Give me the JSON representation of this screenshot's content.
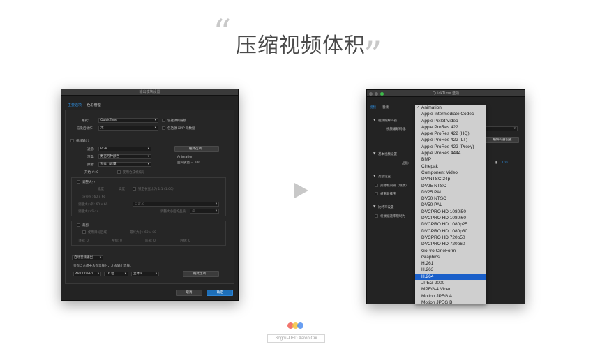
{
  "page": {
    "title": "压缩视频体积",
    "quote_open": "“",
    "quote_close": "”",
    "arrow_icon": "play-arrow-icon",
    "credit": "Sogou-UED Aaron Cui",
    "dot_colors": [
      "#ee5d55",
      "#f3c341",
      "#4f8ef0"
    ]
  },
  "left_dialog": {
    "title": "输出模块设置",
    "tabs": [
      "主要选项",
      "色彩管理"
    ],
    "format_label": "格式:",
    "format_value": "QuickTime",
    "post_render_label": "渲染后动作:",
    "post_render_value": "无",
    "include_project_link": "包括项目链接",
    "include_xmp": "包括源 XMP 元数据",
    "video_output": "视频输出",
    "channels_label": "通道:",
    "channels_value": "RGB",
    "depth_label": "深度:",
    "depth_value": "数百万种颜色",
    "color_label": "颜色:",
    "color_value": "预乘（遮罩）",
    "start_label": "开始 #: 0",
    "use_comp_frame": "使用合成帧编号",
    "format_options_btn": "格式选项...",
    "codec_name": "Animation",
    "codec_quality": "空间质量 = 100",
    "resize": "调整大小",
    "width_label": "宽度",
    "height_label": "高度",
    "lock_aspect": "锁定长宽比为 1:1 (1.00)",
    "render_at": "渲染在:  60    x  60",
    "resize_to": "调整大小到:  60    x  60",
    "custom": "自定义",
    "resize_percent": "调整大小 %:         x",
    "resize_quality": "调整大小后的品质:",
    "resize_quality_value": "高",
    "crop": "裁剪",
    "use_roi": "使用目标区域",
    "final_size": "最终大小: 60 x 60",
    "crop_top": "顶部: 0",
    "crop_left": "左侧: 0",
    "crop_bottom": "底部: 0",
    "crop_right": "右侧: 0",
    "audio_output": "自动音频输出",
    "audio_note": "只有当合成中含有音频时，才会输出音频。",
    "sample_rate": "48.000 kHz",
    "bit_depth": "16 位",
    "channels_audio": "立体声",
    "audio_format_btn": "格式选项...",
    "cancel": "取消",
    "ok": "确定"
  },
  "right_dialog": {
    "title": "QuickTime 选项",
    "tabs": [
      "视频",
      "音频"
    ],
    "video_codec_section": "视频编解码器",
    "video_codec_label": "视频编解码器:",
    "codec_settings_btn": "编解码器设置",
    "basic_settings": "基本视频设置",
    "quality_label": "品质:",
    "quality_value": "100",
    "advanced": "高级设置",
    "keyframe": "关键帧间隔（帧数）",
    "frame_reorder": "帧重新排序",
    "bitrate": "比特率设置",
    "limit_bitrate": "将数据速率限制为",
    "codec_list": [
      "Animation",
      "Apple Intermediate Codec",
      "Apple Pixlet Video",
      "Apple ProRes 422",
      "Apple ProRes 422 (HQ)",
      "Apple ProRes 422 (LT)",
      "Apple ProRes 422 (Proxy)",
      "Apple ProRes 4444",
      "BMP",
      "Cinepak",
      "Component Video",
      "DV/NTSC 24p",
      "DV25 NTSC",
      "DV25 PAL",
      "DV50 NTSC",
      "DV50 PAL",
      "DVCPRO HD 1080i50",
      "DVCPRO HD 1080i60",
      "DVCPRO HD 1080p25",
      "DVCPRO HD 1080p30",
      "DVCPRO HD 720p50",
      "DVCPRO HD 720p60",
      "GoPro CineForm",
      "Graphics",
      "H.261",
      "H.263",
      "H.264",
      "JPEG 2000",
      "MPEG-4 Video",
      "Motion JPEG A",
      "Motion JPEG B"
    ],
    "checked_item": "Animation",
    "highlighted_item": "H.264"
  }
}
